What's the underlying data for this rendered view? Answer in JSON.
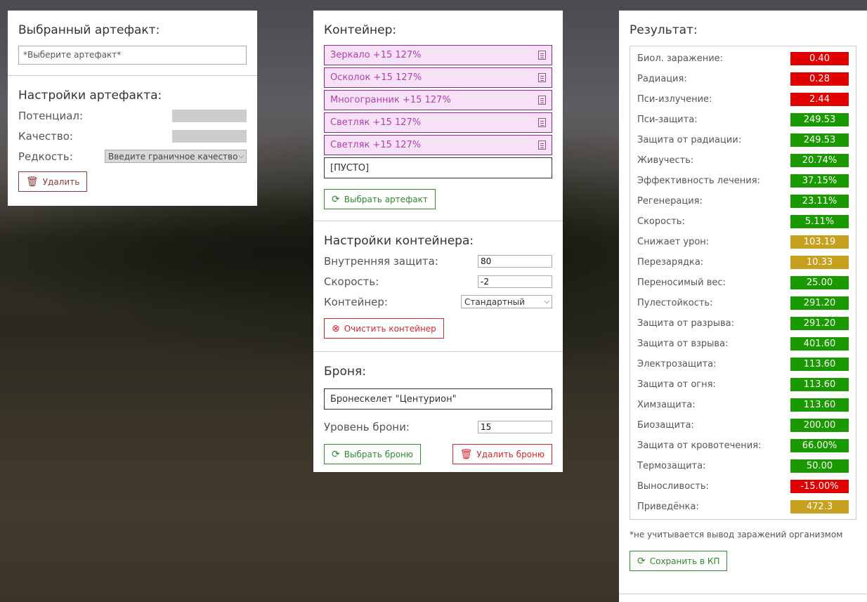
{
  "colors": {
    "red": "#e00000",
    "green": "#1a9a00",
    "yellow": "#c8a020",
    "artifact_bg": "#f7e1f7",
    "artifact_text": "#b040b0"
  },
  "artifact_panel": {
    "title": "Выбранный артефакт:",
    "select_placeholder": "*Выберите артефакт*",
    "settings_title": "Настройки артефакта:",
    "potential_label": "Потенциал:",
    "quality_label": "Качество:",
    "rarity_label": "Редкость:",
    "rarity_value": "Введите граничное качество",
    "delete_label": "Удалить"
  },
  "container_panel": {
    "title": "Контейнер:",
    "artifacts": [
      {
        "label": "Зеркало +15 127%",
        "icon": "document-icon"
      },
      {
        "label": "Осколок +15 127%",
        "icon": "document-icon"
      },
      {
        "label": "Многогранник +15 127%",
        "icon": "document-icon"
      },
      {
        "label": "Светляк +15 127%",
        "icon": "document-icon"
      },
      {
        "label": "Светляк +15 127%",
        "icon": "document-icon"
      }
    ],
    "empty_slot": "[ПУСТО]",
    "select_artifact_label": "Выбрать артефакт",
    "settings_title": "Настройки контейнера:",
    "inner_protection_label": "Внутренняя защита:",
    "inner_protection_value": "80",
    "speed_label": "Скорость:",
    "speed_value": "-2",
    "container_label": "Контейнер:",
    "container_value": "Стандартный",
    "clear_label": "Очистить контейнер"
  },
  "armor_panel": {
    "title": "Броня:",
    "armor_name": "Бронескелет \"Центурион\"",
    "level_label": "Уровень брони:",
    "level_value": "15",
    "select_label": "Выбрать броню",
    "delete_label": "Удалить броню"
  },
  "result_panel": {
    "title": "Результат:",
    "rows": [
      {
        "label": "Биол. заражение:",
        "value": "0.40",
        "status": "red"
      },
      {
        "label": "Радиация:",
        "value": "0.28",
        "status": "red"
      },
      {
        "label": "Пси-излучение:",
        "value": "2.44",
        "status": "red"
      },
      {
        "label": "Пси-защита:",
        "value": "249.53",
        "status": "green"
      },
      {
        "label": "Защита от радиации:",
        "value": "249.53",
        "status": "green"
      },
      {
        "label": "Живучесть:",
        "value": "20.74%",
        "status": "green"
      },
      {
        "label": "Эффективность лечения:",
        "value": "37.15%",
        "status": "green"
      },
      {
        "label": "Регенерация:",
        "value": "23.11%",
        "status": "green"
      },
      {
        "label": "Скорость:",
        "value": "5.11%",
        "status": "green"
      },
      {
        "label": "Снижает урон:",
        "value": "103.19",
        "status": "yellow"
      },
      {
        "label": "Перезарядка:",
        "value": "10.33",
        "status": "yellow"
      },
      {
        "label": "Переносимый вес:",
        "value": "25.00",
        "status": "green"
      },
      {
        "label": "Пулестойкость:",
        "value": "291.20",
        "status": "green"
      },
      {
        "label": "Защита от разрыва:",
        "value": "291.20",
        "status": "green"
      },
      {
        "label": "Защита от взрыва:",
        "value": "401.60",
        "status": "green"
      },
      {
        "label": "Электрозащита:",
        "value": "113.60",
        "status": "green"
      },
      {
        "label": "Защита от огня:",
        "value": "113.60",
        "status": "green"
      },
      {
        "label": "Химзащита:",
        "value": "113.60",
        "status": "green"
      },
      {
        "label": "Биозащита:",
        "value": "200.00",
        "status": "green"
      },
      {
        "label": "Защита от кровотечения:",
        "value": "66.00%",
        "status": "green"
      },
      {
        "label": "Термозащита:",
        "value": "50.00",
        "status": "green"
      },
      {
        "label": "Выносливость:",
        "value": "-15.00%",
        "status": "red"
      },
      {
        "label": "Приведёнка:",
        "value": "472.3",
        "status": "yellow"
      }
    ],
    "note": "*не учитывается вывод заражений организмом",
    "save_label": "Сохранить в КП"
  }
}
